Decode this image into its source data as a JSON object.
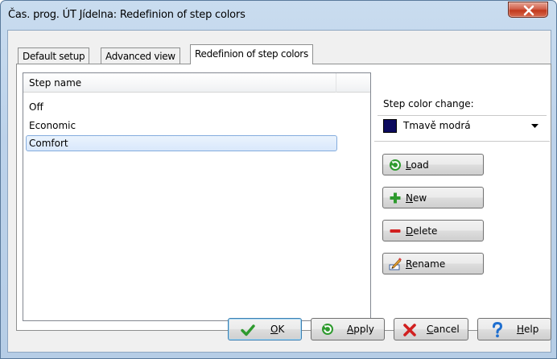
{
  "window": {
    "title": "Čas. prog. ÚT Jídelna: Redefinion of step colors"
  },
  "tabs": [
    {
      "label": "Default setup"
    },
    {
      "label": "Advanced view"
    },
    {
      "label": "Redefinion of step colors"
    }
  ],
  "list": {
    "header": "Step name",
    "items": [
      {
        "label": "Off"
      },
      {
        "label": "Economic"
      },
      {
        "label": "Comfort",
        "selected": true
      }
    ]
  },
  "color_change": {
    "label": "Step color change:",
    "selected_value": "Tmavě modrá",
    "selected_color": "#0c0a5e"
  },
  "side_buttons": {
    "load": {
      "mnemonic": "L",
      "rest": "oad",
      "icon": "refresh-icon"
    },
    "new": {
      "mnemonic": "N",
      "rest": "ew",
      "icon": "plus-icon"
    },
    "delete": {
      "mnemonic": "D",
      "rest": "elete",
      "icon": "minus-icon"
    },
    "rename": {
      "mnemonic": "R",
      "rest": "ename",
      "icon": "rename-icon"
    }
  },
  "bottom_buttons": {
    "ok": {
      "mnemonic": "O",
      "rest": "K",
      "icon": "checkmark-icon"
    },
    "apply": {
      "mnemonic": "A",
      "rest": "pply",
      "icon": "refresh-icon"
    },
    "cancel": {
      "mnemonic": "C",
      "rest": "ancel",
      "icon": "x-icon"
    },
    "help": {
      "mnemonic": "H",
      "rest": "elp",
      "icon": "question-icon"
    }
  },
  "colors": {
    "accent_green": "#2e9a2e",
    "delete_red": "#d12020",
    "selection_border": "#84acdd"
  }
}
